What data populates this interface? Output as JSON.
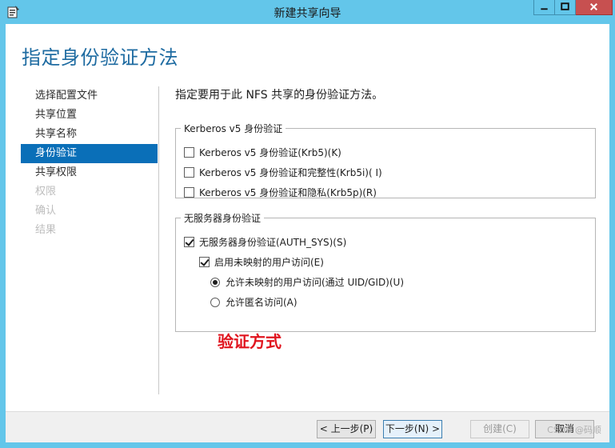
{
  "window": {
    "title": "新建共享向导",
    "icons": {
      "app": "wizard-icon",
      "minimize": "minimize-icon",
      "maximize": "maximize-icon",
      "close": "close-icon"
    },
    "colors": {
      "frame": "#63c6ea",
      "close": "#c75050",
      "accent": "#0a6fb8",
      "title": "#1e6ba1",
      "annotation": "#e0141e"
    }
  },
  "page_title": "指定身份验证方法",
  "nav": {
    "items": [
      {
        "label": "选择配置文件",
        "state": "normal"
      },
      {
        "label": "共享位置",
        "state": "normal"
      },
      {
        "label": "共享名称",
        "state": "normal"
      },
      {
        "label": "身份验证",
        "state": "active"
      },
      {
        "label": "共享权限",
        "state": "normal"
      },
      {
        "label": "权限",
        "state": "disabled"
      },
      {
        "label": "确认",
        "state": "disabled"
      },
      {
        "label": "结果",
        "state": "disabled"
      }
    ]
  },
  "main": {
    "description": "指定要用于此 NFS 共享的身份验证方法。",
    "kerberos": {
      "legend": "Kerberos v5 身份验证",
      "options": [
        {
          "label": "Kerberos v5 身份验证(Krb5)(K)",
          "checked": false
        },
        {
          "label": "Kerberos v5 身份验证和完整性(Krb5i)( I)",
          "checked": false
        },
        {
          "label": "Kerberos v5 身份验证和隐私(Krb5p)(R)",
          "checked": false
        }
      ]
    },
    "no_server": {
      "legend": "无服务器身份验证",
      "auth_sys": {
        "label": "无服务器身份验证(AUTH_SYS)(S)",
        "checked": true
      },
      "unmapped": {
        "label": "启用未映射的用户访问(E)",
        "checked": true
      },
      "radios": [
        {
          "label": "允许未映射的用户访问(通过 UID/GID)(U)",
          "selected": true
        },
        {
          "label": "允许匿名访问(A)",
          "selected": false
        }
      ]
    }
  },
  "annotation": "验证方式",
  "footer": {
    "prev": "< 上一步(P)",
    "next": "下一步(N) >",
    "create": "创建(C)",
    "cancel": "取消"
  },
  "watermark": "CSDN @码顺"
}
